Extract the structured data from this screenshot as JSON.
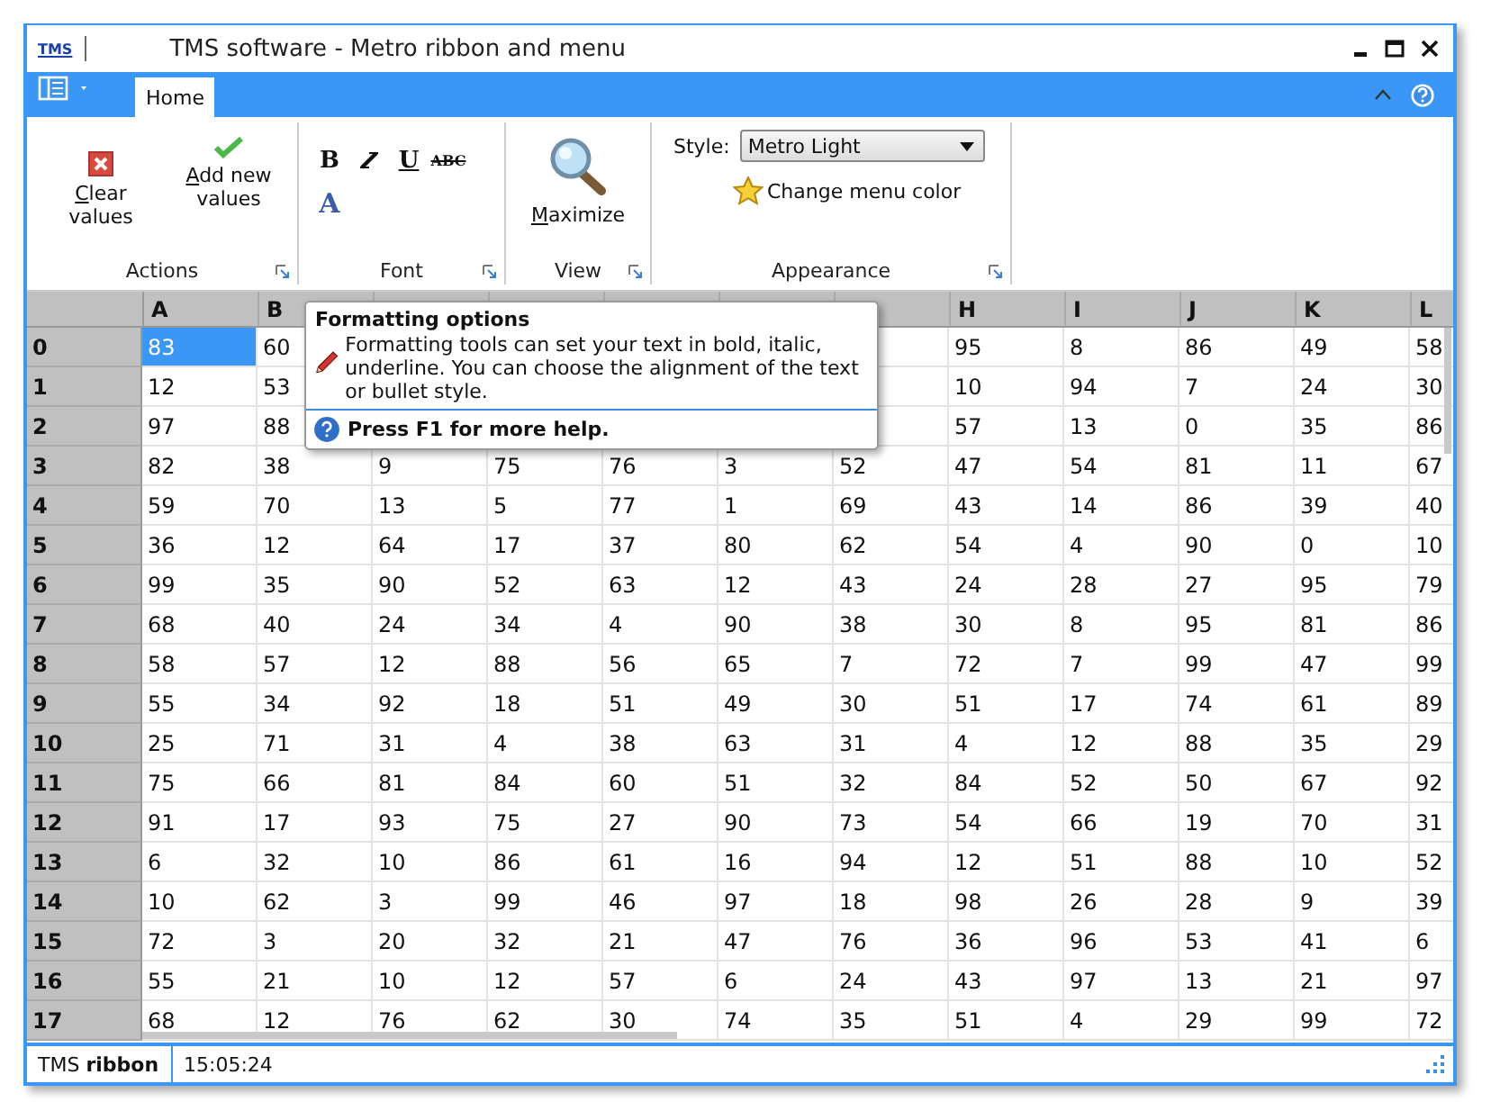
{
  "window": {
    "logo": "TMS",
    "title": "TMS software - Metro ribbon and menu"
  },
  "ribbon": {
    "tabs": [
      {
        "label": "Home",
        "selected": true
      }
    ],
    "groups": [
      {
        "kind": "actions",
        "label": "Actions",
        "buttons": [
          {
            "kind": "clear",
            "label": "Clear values"
          },
          {
            "kind": "add",
            "label": "Add new values"
          }
        ]
      },
      {
        "kind": "font",
        "label": "Font",
        "buttons": [
          {
            "kind": "bold",
            "label": "B"
          },
          {
            "kind": "italic"
          },
          {
            "kind": "underline",
            "label": "U"
          },
          {
            "kind": "strike",
            "label": "ABC"
          },
          {
            "kind": "color",
            "label": "A"
          }
        ]
      },
      {
        "kind": "view",
        "label": "View",
        "buttons": [
          {
            "kind": "zoom",
            "label": "Maximize"
          }
        ]
      },
      {
        "kind": "appearance",
        "label": "Appearance",
        "style_label": "Style:",
        "style_value": "Metro Light",
        "buttons": [
          {
            "kind": "star",
            "label": "Change menu color"
          }
        ]
      }
    ]
  },
  "grid": {
    "columns": [
      "A",
      "B",
      null,
      null,
      null,
      null,
      null,
      "H",
      "I",
      "J",
      "K",
      "L"
    ],
    "rows": [
      {
        "header": "0",
        "cells": [
          {
            "v": "83",
            "selected": true
          },
          {
            "v": "60",
            "selected": false
          },
          null,
          null,
          null,
          null,
          null,
          {
            "v": "95",
            "selected": false
          },
          {
            "v": "8",
            "selected": false
          },
          {
            "v": "86",
            "selected": false
          },
          {
            "v": "49",
            "selected": false
          },
          {
            "v": "58",
            "selected": false
          }
        ]
      },
      {
        "header": "1",
        "cells": [
          {
            "v": "12",
            "selected": false
          },
          {
            "v": "53",
            "selected": false
          },
          null,
          null,
          null,
          null,
          null,
          {
            "v": "10",
            "selected": false
          },
          {
            "v": "94",
            "selected": false
          },
          {
            "v": "7",
            "selected": false
          },
          {
            "v": "24",
            "selected": false
          },
          {
            "v": "30",
            "selected": false
          }
        ]
      },
      {
        "header": "2",
        "cells": [
          {
            "v": "97",
            "selected": false
          },
          {
            "v": "88",
            "selected": false
          },
          null,
          null,
          null,
          null,
          null,
          {
            "v": "57",
            "selected": false
          },
          {
            "v": "13",
            "selected": false
          },
          {
            "v": "0",
            "selected": false
          },
          {
            "v": "35",
            "selected": false
          },
          {
            "v": "86",
            "selected": false
          }
        ]
      },
      {
        "header": "3",
        "cells": [
          {
            "v": "82",
            "selected": false
          },
          {
            "v": "38",
            "selected": false
          },
          {
            "v": "9",
            "selected": false
          },
          {
            "v": "75",
            "selected": false
          },
          {
            "v": "76",
            "selected": false
          },
          {
            "v": "3",
            "selected": false
          },
          {
            "v": "52",
            "selected": false
          },
          {
            "v": "47",
            "selected": false
          },
          {
            "v": "54",
            "selected": false
          },
          {
            "v": "81",
            "selected": false
          },
          {
            "v": "11",
            "selected": false
          },
          {
            "v": "67",
            "selected": false
          }
        ]
      },
      {
        "header": "4",
        "cells": [
          {
            "v": "59",
            "selected": false
          },
          {
            "v": "70",
            "selected": false
          },
          {
            "v": "13",
            "selected": false
          },
          {
            "v": "5",
            "selected": false
          },
          {
            "v": "77",
            "selected": false
          },
          {
            "v": "1",
            "selected": false
          },
          {
            "v": "69",
            "selected": false
          },
          {
            "v": "43",
            "selected": false
          },
          {
            "v": "14",
            "selected": false
          },
          {
            "v": "86",
            "selected": false
          },
          {
            "v": "39",
            "selected": false
          },
          {
            "v": "40",
            "selected": false
          }
        ]
      },
      {
        "header": "5",
        "cells": [
          {
            "v": "36",
            "selected": false
          },
          {
            "v": "12",
            "selected": false
          },
          {
            "v": "64",
            "selected": false
          },
          {
            "v": "17",
            "selected": false
          },
          {
            "v": "37",
            "selected": false
          },
          {
            "v": "80",
            "selected": false
          },
          {
            "v": "62",
            "selected": false
          },
          {
            "v": "54",
            "selected": false
          },
          {
            "v": "4",
            "selected": false
          },
          {
            "v": "90",
            "selected": false
          },
          {
            "v": "0",
            "selected": false
          },
          {
            "v": "10",
            "selected": false
          }
        ]
      },
      {
        "header": "6",
        "cells": [
          {
            "v": "99",
            "selected": false
          },
          {
            "v": "35",
            "selected": false
          },
          {
            "v": "90",
            "selected": false
          },
          {
            "v": "52",
            "selected": false
          },
          {
            "v": "63",
            "selected": false
          },
          {
            "v": "12",
            "selected": false
          },
          {
            "v": "43",
            "selected": false
          },
          {
            "v": "24",
            "selected": false
          },
          {
            "v": "28",
            "selected": false
          },
          {
            "v": "27",
            "selected": false
          },
          {
            "v": "95",
            "selected": false
          },
          {
            "v": "79",
            "selected": false
          }
        ]
      },
      {
        "header": "7",
        "cells": [
          {
            "v": "68",
            "selected": false
          },
          {
            "v": "40",
            "selected": false
          },
          {
            "v": "24",
            "selected": false
          },
          {
            "v": "34",
            "selected": false
          },
          {
            "v": "4",
            "selected": false
          },
          {
            "v": "90",
            "selected": false
          },
          {
            "v": "38",
            "selected": false
          },
          {
            "v": "30",
            "selected": false
          },
          {
            "v": "8",
            "selected": false
          },
          {
            "v": "95",
            "selected": false
          },
          {
            "v": "81",
            "selected": false
          },
          {
            "v": "86",
            "selected": false
          }
        ]
      },
      {
        "header": "8",
        "cells": [
          {
            "v": "58",
            "selected": false
          },
          {
            "v": "57",
            "selected": false
          },
          {
            "v": "12",
            "selected": false
          },
          {
            "v": "88",
            "selected": false
          },
          {
            "v": "56",
            "selected": false
          },
          {
            "v": "65",
            "selected": false
          },
          {
            "v": "7",
            "selected": false
          },
          {
            "v": "72",
            "selected": false
          },
          {
            "v": "7",
            "selected": false
          },
          {
            "v": "99",
            "selected": false
          },
          {
            "v": "47",
            "selected": false
          },
          {
            "v": "99",
            "selected": false
          }
        ]
      },
      {
        "header": "9",
        "cells": [
          {
            "v": "55",
            "selected": false
          },
          {
            "v": "34",
            "selected": false
          },
          {
            "v": "92",
            "selected": false
          },
          {
            "v": "18",
            "selected": false
          },
          {
            "v": "51",
            "selected": false
          },
          {
            "v": "49",
            "selected": false
          },
          {
            "v": "30",
            "selected": false
          },
          {
            "v": "51",
            "selected": false
          },
          {
            "v": "17",
            "selected": false
          },
          {
            "v": "74",
            "selected": false
          },
          {
            "v": "61",
            "selected": false
          },
          {
            "v": "89",
            "selected": false
          }
        ]
      },
      {
        "header": "10",
        "cells": [
          {
            "v": "25",
            "selected": false
          },
          {
            "v": "71",
            "selected": false
          },
          {
            "v": "31",
            "selected": false
          },
          {
            "v": "4",
            "selected": false
          },
          {
            "v": "38",
            "selected": false
          },
          {
            "v": "63",
            "selected": false
          },
          {
            "v": "31",
            "selected": false
          },
          {
            "v": "4",
            "selected": false
          },
          {
            "v": "12",
            "selected": false
          },
          {
            "v": "88",
            "selected": false
          },
          {
            "v": "35",
            "selected": false
          },
          {
            "v": "29",
            "selected": false
          }
        ]
      },
      {
        "header": "11",
        "cells": [
          {
            "v": "75",
            "selected": false
          },
          {
            "v": "66",
            "selected": false
          },
          {
            "v": "81",
            "selected": false
          },
          {
            "v": "84",
            "selected": false
          },
          {
            "v": "60",
            "selected": false
          },
          {
            "v": "51",
            "selected": false
          },
          {
            "v": "32",
            "selected": false
          },
          {
            "v": "84",
            "selected": false
          },
          {
            "v": "52",
            "selected": false
          },
          {
            "v": "50",
            "selected": false
          },
          {
            "v": "67",
            "selected": false
          },
          {
            "v": "92",
            "selected": false
          }
        ]
      },
      {
        "header": "12",
        "cells": [
          {
            "v": "91",
            "selected": false
          },
          {
            "v": "17",
            "selected": false
          },
          {
            "v": "93",
            "selected": false
          },
          {
            "v": "75",
            "selected": false
          },
          {
            "v": "27",
            "selected": false
          },
          {
            "v": "90",
            "selected": false
          },
          {
            "v": "73",
            "selected": false
          },
          {
            "v": "54",
            "selected": false
          },
          {
            "v": "66",
            "selected": false
          },
          {
            "v": "19",
            "selected": false
          },
          {
            "v": "70",
            "selected": false
          },
          {
            "v": "31",
            "selected": false
          }
        ]
      },
      {
        "header": "13",
        "cells": [
          {
            "v": "6",
            "selected": false
          },
          {
            "v": "32",
            "selected": false
          },
          {
            "v": "10",
            "selected": false
          },
          {
            "v": "86",
            "selected": false
          },
          {
            "v": "61",
            "selected": false
          },
          {
            "v": "16",
            "selected": false
          },
          {
            "v": "94",
            "selected": false
          },
          {
            "v": "12",
            "selected": false
          },
          {
            "v": "51",
            "selected": false
          },
          {
            "v": "88",
            "selected": false
          },
          {
            "v": "10",
            "selected": false
          },
          {
            "v": "52",
            "selected": false
          }
        ]
      },
      {
        "header": "14",
        "cells": [
          {
            "v": "10",
            "selected": false
          },
          {
            "v": "62",
            "selected": false
          },
          {
            "v": "3",
            "selected": false
          },
          {
            "v": "99",
            "selected": false
          },
          {
            "v": "46",
            "selected": false
          },
          {
            "v": "97",
            "selected": false
          },
          {
            "v": "18",
            "selected": false
          },
          {
            "v": "98",
            "selected": false
          },
          {
            "v": "26",
            "selected": false
          },
          {
            "v": "28",
            "selected": false
          },
          {
            "v": "9",
            "selected": false
          },
          {
            "v": "39",
            "selected": false
          }
        ]
      },
      {
        "header": "15",
        "cells": [
          {
            "v": "72",
            "selected": false
          },
          {
            "v": "3",
            "selected": false
          },
          {
            "v": "20",
            "selected": false
          },
          {
            "v": "32",
            "selected": false
          },
          {
            "v": "21",
            "selected": false
          },
          {
            "v": "47",
            "selected": false
          },
          {
            "v": "76",
            "selected": false
          },
          {
            "v": "36",
            "selected": false
          },
          {
            "v": "96",
            "selected": false
          },
          {
            "v": "53",
            "selected": false
          },
          {
            "v": "41",
            "selected": false
          },
          {
            "v": "6",
            "selected": false
          }
        ]
      },
      {
        "header": "16",
        "cells": [
          {
            "v": "55",
            "selected": false
          },
          {
            "v": "21",
            "selected": false
          },
          {
            "v": "10",
            "selected": false
          },
          {
            "v": "12",
            "selected": false
          },
          {
            "v": "57",
            "selected": false
          },
          {
            "v": "6",
            "selected": false
          },
          {
            "v": "24",
            "selected": false
          },
          {
            "v": "43",
            "selected": false
          },
          {
            "v": "97",
            "selected": false
          },
          {
            "v": "13",
            "selected": false
          },
          {
            "v": "21",
            "selected": false
          },
          {
            "v": "97",
            "selected": false
          }
        ]
      },
      {
        "header": "17",
        "cells": [
          {
            "v": "68",
            "selected": false
          },
          {
            "v": "12",
            "selected": false
          },
          {
            "v": "76",
            "selected": false
          },
          {
            "v": "62",
            "selected": false
          },
          {
            "v": "30",
            "selected": false
          },
          {
            "v": "74",
            "selected": false
          },
          {
            "v": "35",
            "selected": false
          },
          {
            "v": "51",
            "selected": false
          },
          {
            "v": "4",
            "selected": false
          },
          {
            "v": "29",
            "selected": false
          },
          {
            "v": "99",
            "selected": false
          },
          {
            "v": "72",
            "selected": false
          }
        ]
      }
    ]
  },
  "tooltip": {
    "title": "Formatting options",
    "body": "Formatting tools can set your text in bold, italic, underline. You can choose the alignment of the text or bullet style.",
    "footer": "Press F1 for more help."
  },
  "status_bar": {
    "panels": [
      "TMS **ribbon**",
      "15:05:24"
    ]
  }
}
